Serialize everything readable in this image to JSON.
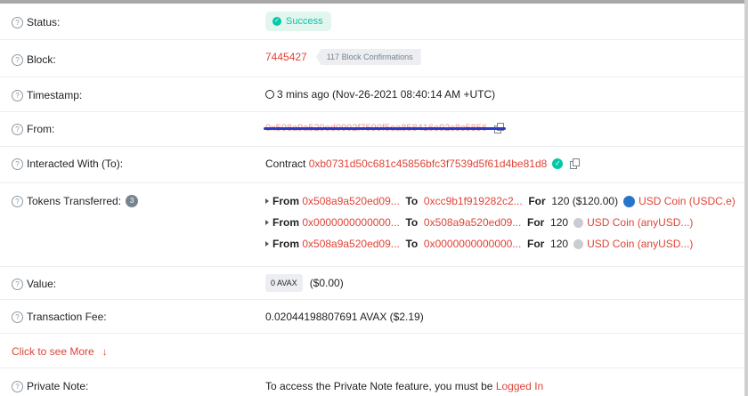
{
  "status": {
    "label": "Status:",
    "value": "Success"
  },
  "block": {
    "label": "Block:",
    "number": "7445427",
    "confirmations": "117 Block Confirmations"
  },
  "timestamp": {
    "label": "Timestamp:",
    "value": "3 mins ago (Nov-26-2021 08:40:14 AM +UTC)"
  },
  "from": {
    "label": "From:",
    "address": "0x508a9a520ed0992f7590f5ea858416e92c8c5856"
  },
  "interacted": {
    "label": "Interacted With (To):",
    "prefix": "Contract",
    "address": "0xb0731d50c681c45856bfc3f7539d5f61d4be81d8"
  },
  "tokens": {
    "label": "Tokens Transferred:",
    "count": "3",
    "from_label": "From",
    "to_label": "To",
    "for_label": "For",
    "rows": [
      {
        "from": "0x508a9a520ed09...",
        "to": "0xcc9b1f919282c2...",
        "amount": "120",
        "usd": "($120.00)",
        "token": "USD Coin (USDC.e)",
        "icon": "usdc-icon"
      },
      {
        "from": "0x0000000000000...",
        "to": "0x508a9a520ed09...",
        "amount": "120",
        "usd": "",
        "token": "USD Coin (anyUSD...)",
        "icon": "anyusd-icon"
      },
      {
        "from": "0x508a9a520ed09...",
        "to": "0x0000000000000...",
        "amount": "120",
        "usd": "",
        "token": "USD Coin (anyUSD...)",
        "icon": "anyusd-icon"
      }
    ]
  },
  "value": {
    "label": "Value:",
    "badge": "0 AVAX",
    "usd": "($0.00)"
  },
  "fee": {
    "label": "Transaction Fee:",
    "value": "0.02044198807691 AVAX ($2.19)"
  },
  "more": {
    "label": "Click to see More"
  },
  "note": {
    "label": "Private Note:",
    "text": "To access the Private Note feature, you must be",
    "link": "Logged In"
  },
  "colors": {
    "accent": "#de4437",
    "success": "#00c9a7",
    "redaction": "#2a3bc4"
  }
}
